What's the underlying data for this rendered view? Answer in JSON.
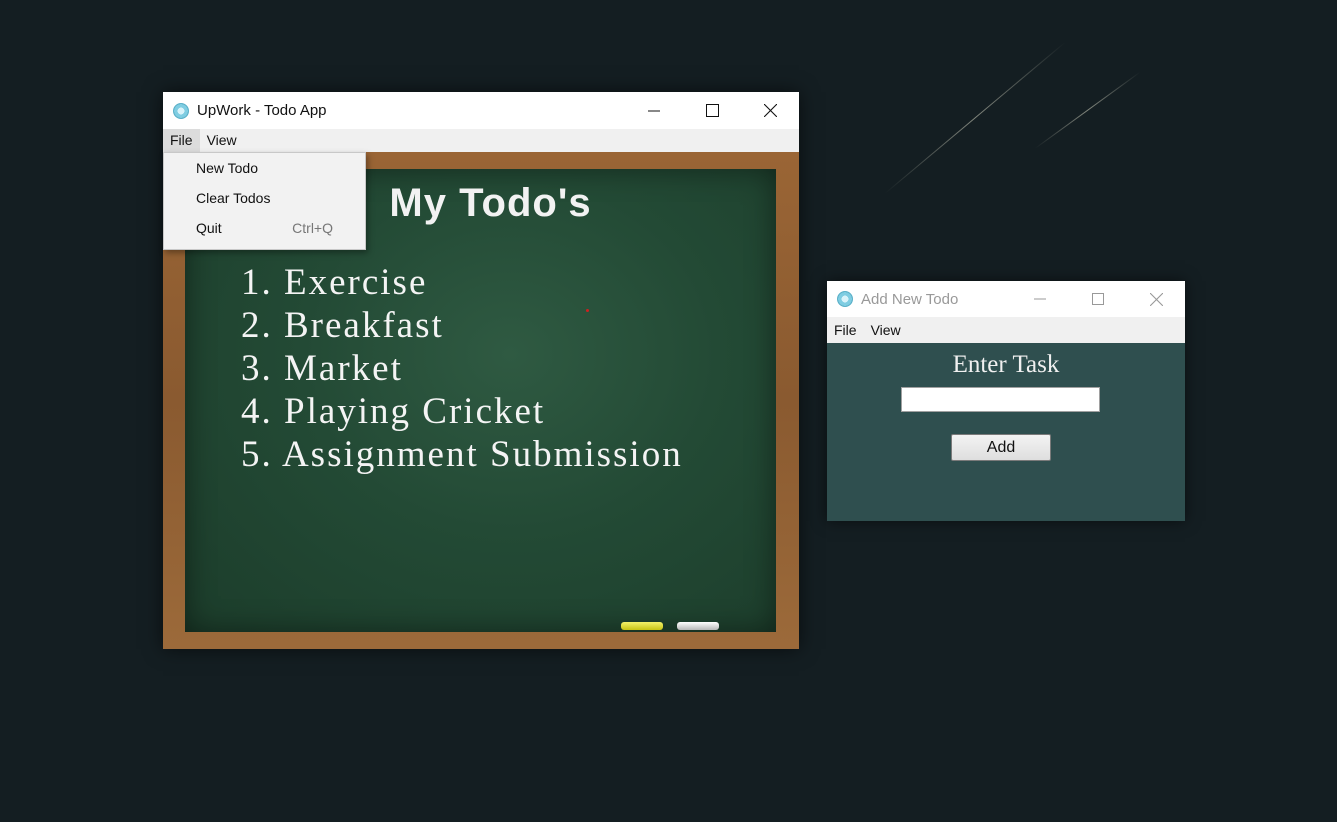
{
  "main_window": {
    "title": "UpWork - Todo App",
    "menu": [
      "File",
      "View"
    ],
    "board_title": "My Todo's",
    "todos": [
      "1. Exercise",
      "2. Breakfast",
      "3. Market",
      "4. Playing Cricket",
      "5. Assignment Submission"
    ]
  },
  "file_menu": {
    "items": [
      {
        "label": "New Todo",
        "shortcut": ""
      },
      {
        "label": "Clear Todos",
        "shortcut": ""
      },
      {
        "label": "Quit",
        "shortcut": "Ctrl+Q"
      }
    ]
  },
  "add_window": {
    "title": "Add New Todo",
    "menu": [
      "File",
      "View"
    ],
    "heading": "Enter Task",
    "input_value": "",
    "add_label": "Add"
  },
  "colors": {
    "desktop": "#141e22",
    "board": "#234a35",
    "frame": "#8a5a30",
    "add_window_bg": "#2f4f4f"
  }
}
